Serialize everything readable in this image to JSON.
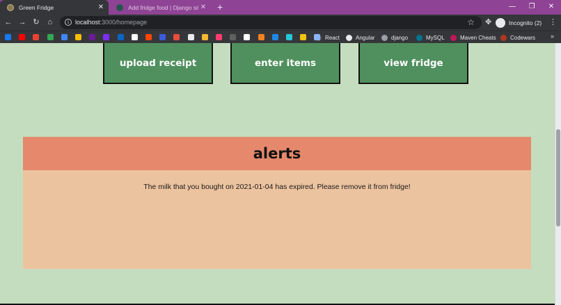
{
  "browser": {
    "tabs": [
      {
        "title": "Green Fridge",
        "close": "✕"
      },
      {
        "title": "Add fridge food | Django site ad",
        "close": "✕"
      }
    ],
    "new_tab": "+",
    "window_controls": {
      "minimize": "—",
      "restore": "❐",
      "close": "✕"
    },
    "nav": {
      "back": "←",
      "forward": "→",
      "reload": "↻",
      "home": "⌂"
    },
    "address": {
      "host": "localhost",
      "path": ":3000/homepage"
    },
    "star": "☆",
    "extensions": "✥",
    "profile_label": "Incognito (2)",
    "menu": "⋮",
    "bookmarks": {
      "icon_colors": [
        "#1877f2",
        "#ff0000",
        "#ea4335",
        "#34a853",
        "#4285f4",
        "#fbbc04",
        "#6a1b9a",
        "#7b2ff7",
        "#0a66c2",
        "#ffffff",
        "#ff4500",
        "#3b5bdb",
        "#e74c3c",
        "#e8eaed",
        "#f7b731",
        "#ff3d6e",
        "#5f5f5f",
        "#ffffff",
        "#f58220",
        "#1e88e5",
        "#26c6da",
        "#f1c40f",
        "#8ab4f8"
      ],
      "named": [
        {
          "label": "React",
          "color": "#5f5f5f"
        },
        {
          "label": "Angular",
          "color": "#e8eaed"
        },
        {
          "label": "django",
          "color": "#9aa0a6"
        },
        {
          "label": "MySQL",
          "color": "#00758f"
        },
        {
          "label": "Maven Cheats",
          "color": "#c2185b"
        },
        {
          "label": "Codewars",
          "color": "#b1361e"
        }
      ],
      "more": "»"
    }
  },
  "page": {
    "nav_buttons": [
      "upload receipt",
      "enter items",
      "view fridge"
    ],
    "alerts": {
      "heading": "alerts",
      "messages": [
        "The milk that you bought on 2021-01-04 has expired. Please remove it from fridge!"
      ]
    }
  },
  "colors": {
    "page_background": "#c5ddbf",
    "nav_button": "#50905e",
    "alerts_header": "#e5886b",
    "alerts_body": "#ecc39f",
    "tab_strip": "#8e4394"
  }
}
